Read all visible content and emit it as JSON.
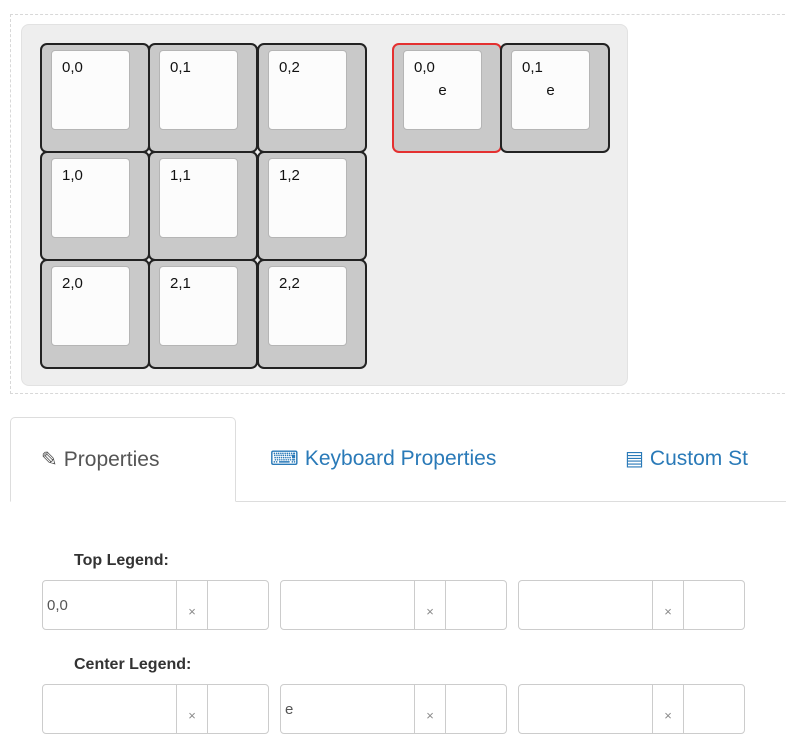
{
  "keyboard": {
    "keys": [
      {
        "top": "0,0",
        "center": ""
      },
      {
        "top": "0,1",
        "center": ""
      },
      {
        "top": "0,2",
        "center": ""
      },
      {
        "top": "1,0",
        "center": ""
      },
      {
        "top": "1,1",
        "center": ""
      },
      {
        "top": "1,2",
        "center": ""
      },
      {
        "top": "2,0",
        "center": ""
      },
      {
        "top": "2,1",
        "center": ""
      },
      {
        "top": "2,2",
        "center": ""
      },
      {
        "top": "0,0",
        "center": "e",
        "selected": true
      },
      {
        "top": "0,1",
        "center": "e"
      }
    ],
    "colors": {
      "key_cap": "#c9c9c9",
      "key_top": "#fcfcfc",
      "key_border": "#222222",
      "selected_border": "#e43030",
      "canvas_bg": "#eeeeee"
    }
  },
  "tabs": [
    {
      "label": "Properties",
      "icon": "edit-icon",
      "active": true
    },
    {
      "label": "Keyboard Properties",
      "icon": "keyboard-icon",
      "active": false
    },
    {
      "label": "Custom St",
      "icon": "document-icon",
      "active": false
    }
  ],
  "properties": {
    "top_legend_label": "Top Legend:",
    "top_legend_values": [
      "0,0",
      "",
      ""
    ],
    "center_legend_label": "Center Legend:",
    "center_legend_values": [
      "",
      "e",
      ""
    ],
    "x_glyph": "×"
  },
  "colors": {
    "link": "#2a7ab8",
    "tab_active_text": "#555555"
  }
}
